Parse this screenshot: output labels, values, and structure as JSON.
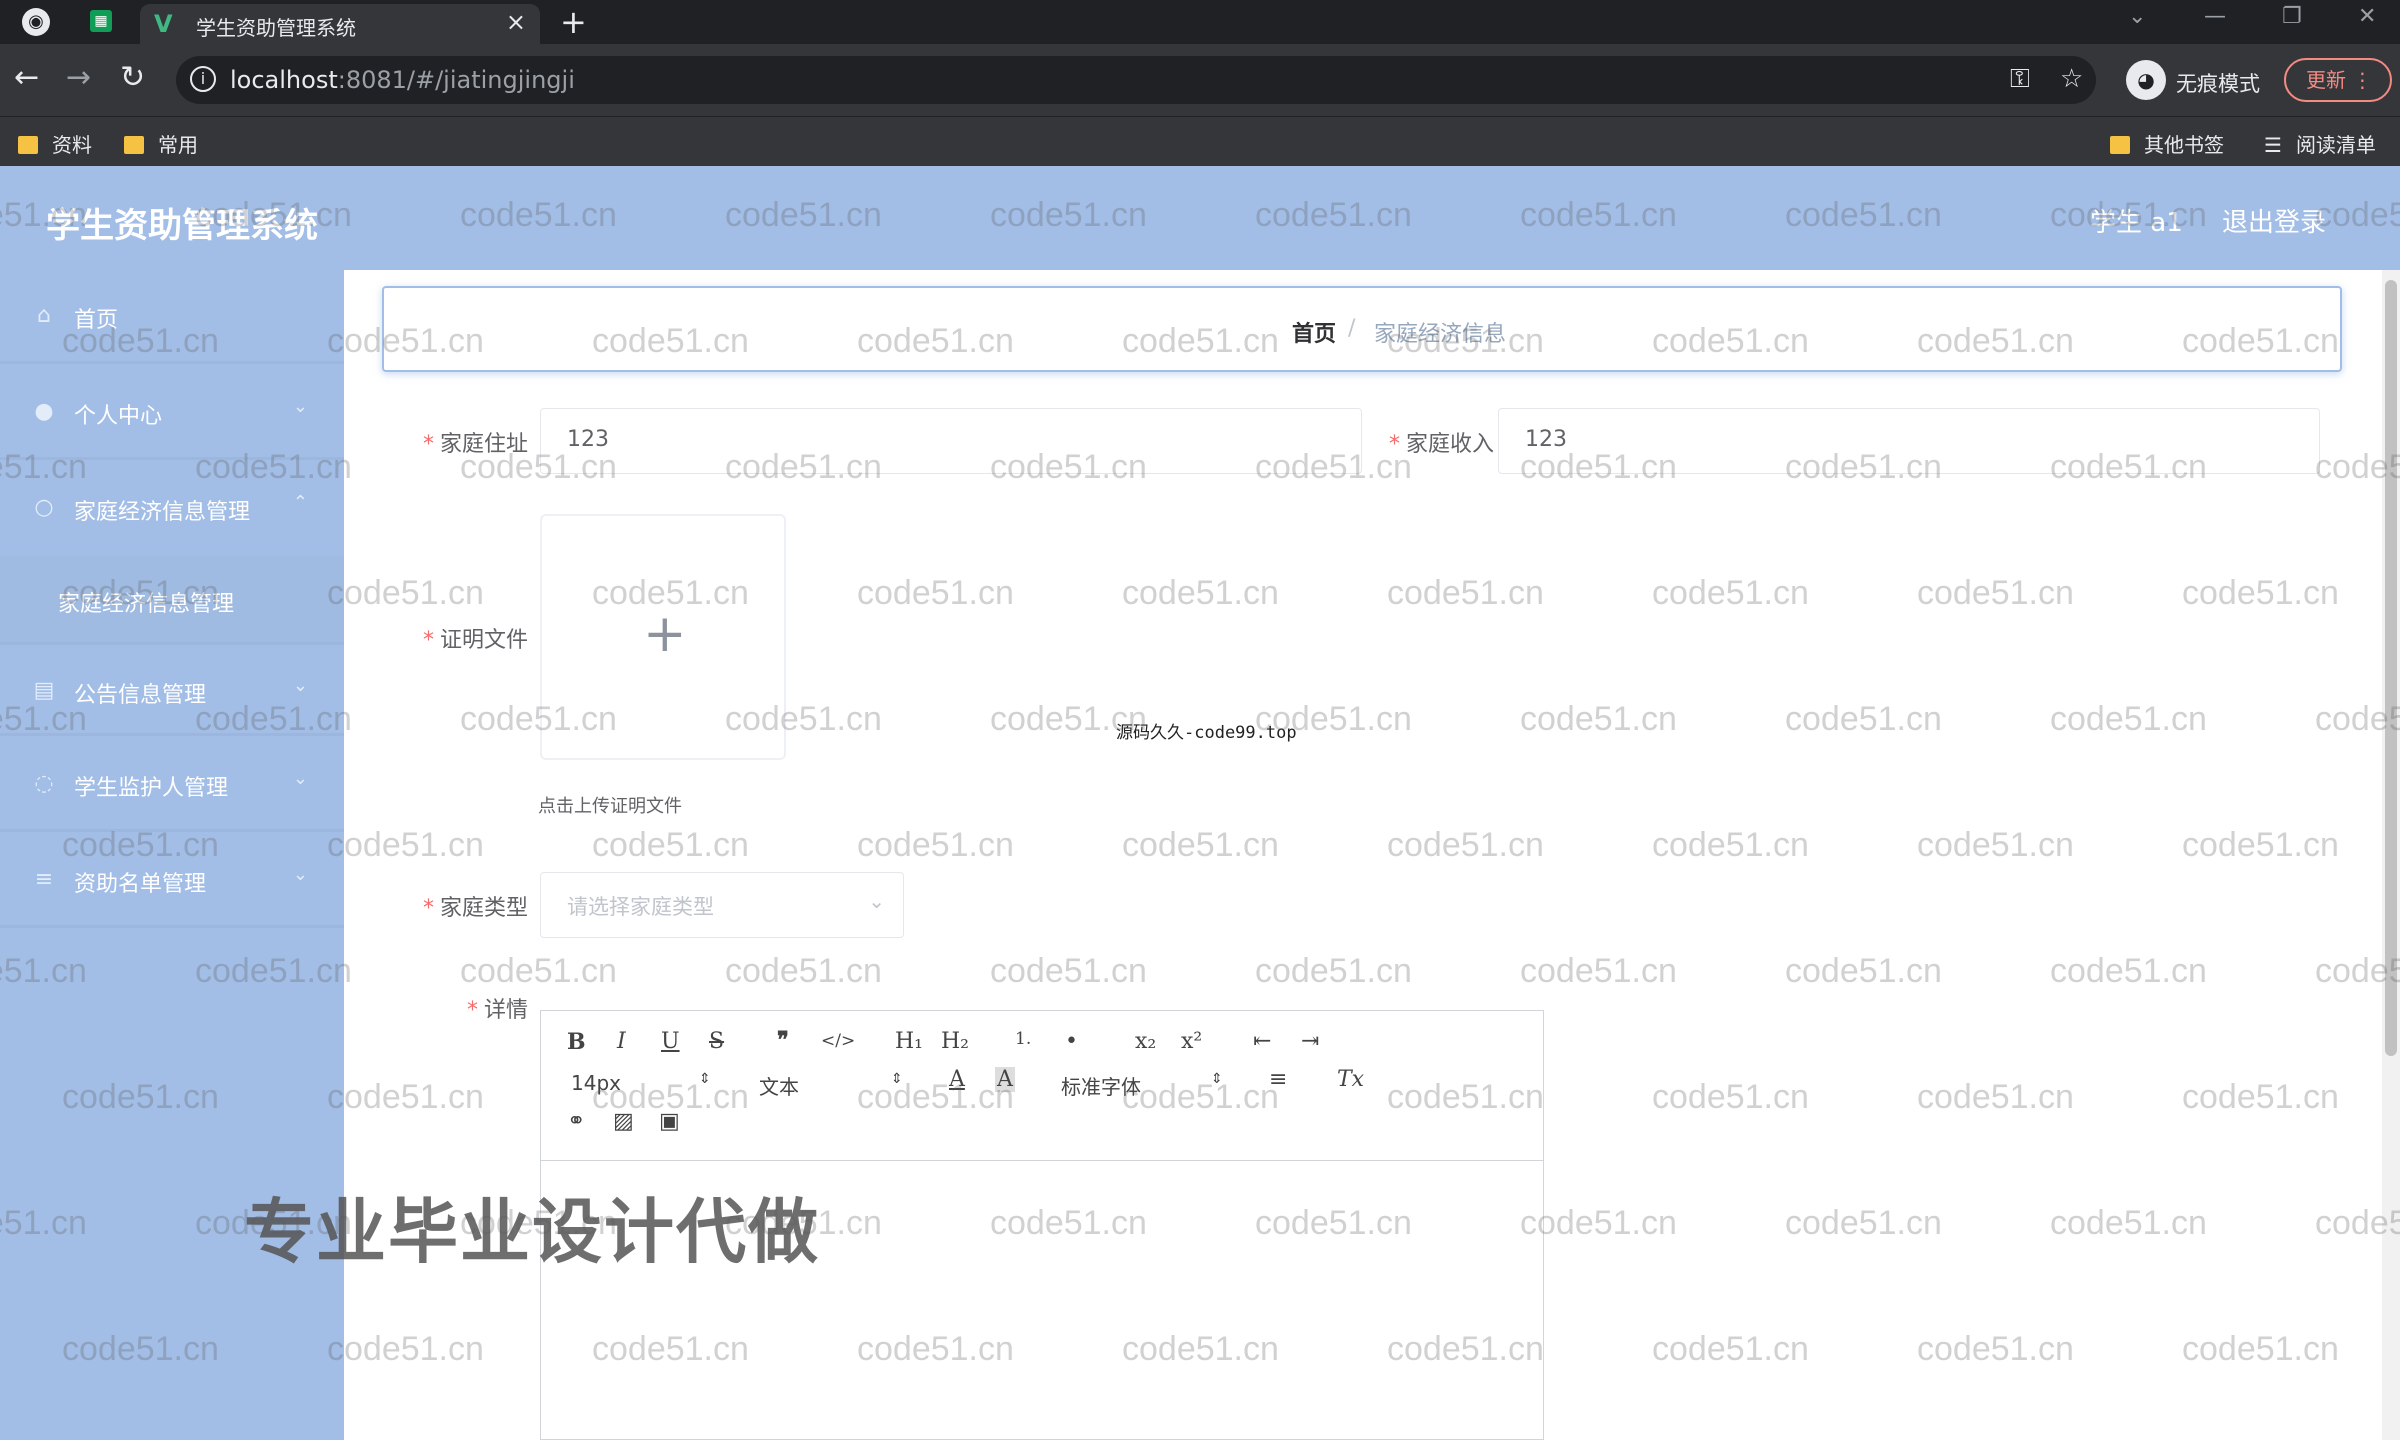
{
  "browser": {
    "tab_title": "学生资助管理系统",
    "url_host": "localhost",
    "url_rest": ":8081/#/jiatingjingji",
    "incognito_label": "无痕模式",
    "update_label": "更新",
    "bookmarks": [
      "资料",
      "常用"
    ],
    "other_bookmarks": "其他书签",
    "reading_list": "阅读清单"
  },
  "header": {
    "title": "学生资助管理系统",
    "user": "学生 a1",
    "logout": "退出登录"
  },
  "sidebar": {
    "items": [
      {
        "label": "首页",
        "icon": "home-icon"
      },
      {
        "label": "个人中心",
        "icon": "user-icon"
      },
      {
        "label": "家庭经济信息管理",
        "icon": "circle-icon"
      },
      {
        "label": "家庭经济信息管理",
        "icon": ""
      },
      {
        "label": "公告信息管理",
        "icon": "list-icon"
      },
      {
        "label": "学生监护人管理",
        "icon": "circle-icon"
      },
      {
        "label": "资助名单管理",
        "icon": "menu-icon"
      }
    ]
  },
  "breadcrumb": {
    "home": "首页",
    "separator": "/",
    "current": "家庭经济信息"
  },
  "form": {
    "address_label": "家庭住址",
    "address_value": "123",
    "income_label": "家庭收入",
    "income_value": "123",
    "proof_label": "证明文件",
    "upload_plus": "+",
    "upload_tip": "点击上传证明文件",
    "type_label": "家庭类型",
    "type_placeholder": "请选择家庭类型",
    "detail_label": "详情",
    "required_mark": "*"
  },
  "editor": {
    "buttons": [
      "B",
      "I",
      "U",
      "S",
      "❞",
      "</>",
      "H₁",
      "H₂",
      "1.",
      "•",
      "x₂",
      "x²",
      "⇤",
      "⇥"
    ],
    "font_size": "14px",
    "text_style": "文本",
    "font_family": "标准字体",
    "clear_format": "Tx"
  },
  "overlays": {
    "promo": "专业毕业设计代做",
    "source": "源码久久-code99.top",
    "watermark": "code51.cn"
  }
}
